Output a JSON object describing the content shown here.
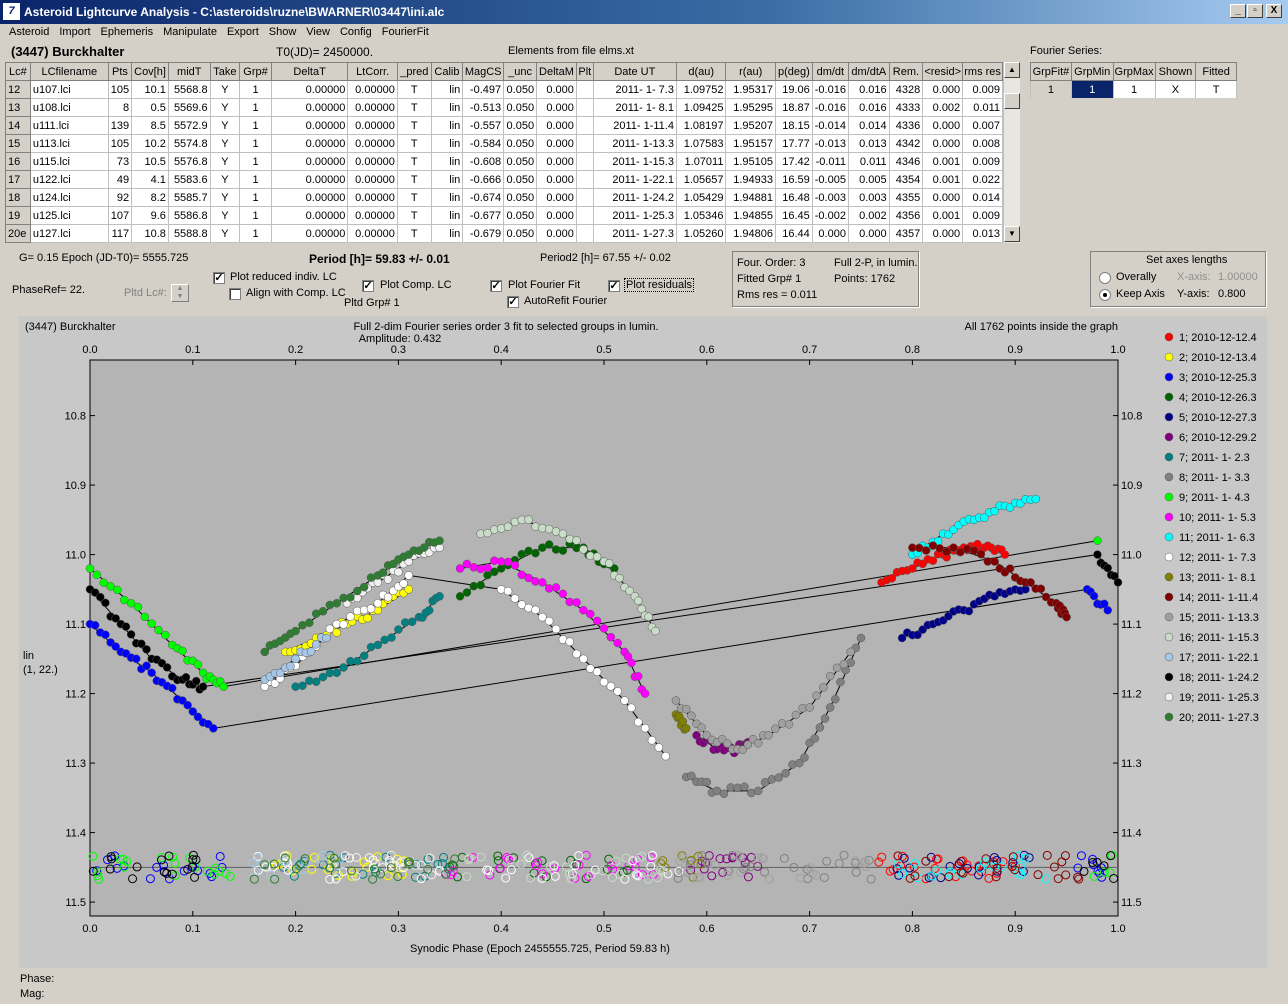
{
  "window": {
    "title": "Asteroid Lightcurve Analysis - C:\\asteroids\\ruzne\\BWARNER\\03447\\ini.alc",
    "icon_text": "7",
    "min_glyph": "_",
    "restore_glyph": "▫",
    "close_glyph": "X"
  },
  "menu": [
    "Asteroid",
    "Import",
    "Ephemeris",
    "Manipulate",
    "Export",
    "Show",
    "View",
    "Config",
    "FourierFit"
  ],
  "header": {
    "asteroid": "(3447) Burckhalter",
    "t0": "T0(JD)= 2450000.",
    "elements": "Elements from file elms.xt"
  },
  "table": {
    "columns": [
      "Lc#",
      "LCfilename",
      "Pts",
      "Cov[h]",
      "midT",
      "Take",
      "Grp#",
      "DeltaT",
      "LtCorr.",
      "_pred",
      "Calib",
      "MagCS",
      "_unc",
      "DeltaM",
      "Plt",
      "Date UT",
      "d(au)",
      "r(au)",
      "p(deg)",
      "dm/dt",
      "dm/dtA",
      "Rem.",
      "<resid>",
      "rms res"
    ],
    "rows": [
      [
        "12",
        "u107.lci",
        "105",
        "10.1",
        "5568.8",
        "Y",
        "1",
        "0.00000",
        "0.00000",
        "T",
        "lin",
        "-0.497",
        "0.050",
        "0.000",
        "",
        "2011- 1- 7.3",
        "1.09752",
        "1.95317",
        "19.06",
        "-0.016",
        "0.016",
        "4328",
        "0.000",
        "0.009"
      ],
      [
        "13",
        "u108.lci",
        "8",
        "0.5",
        "5569.6",
        "Y",
        "1",
        "0.00000",
        "0.00000",
        "T",
        "lin",
        "-0.513",
        "0.050",
        "0.000",
        "",
        "2011- 1- 8.1",
        "1.09425",
        "1.95295",
        "18.87",
        "-0.016",
        "0.016",
        "4333",
        "0.002",
        "0.011"
      ],
      [
        "14",
        "u111.lci",
        "139",
        "8.5",
        "5572.9",
        "Y",
        "1",
        "0.00000",
        "0.00000",
        "T",
        "lin",
        "-0.557",
        "0.050",
        "0.000",
        "",
        "2011- 1-11.4",
        "1.08197",
        "1.95207",
        "18.15",
        "-0.014",
        "0.014",
        "4336",
        "0.000",
        "0.007"
      ],
      [
        "15",
        "u113.lci",
        "105",
        "10.2",
        "5574.8",
        "Y",
        "1",
        "0.00000",
        "0.00000",
        "T",
        "lin",
        "-0.584",
        "0.050",
        "0.000",
        "",
        "2011- 1-13.3",
        "1.07583",
        "1.95157",
        "17.77",
        "-0.013",
        "0.013",
        "4342",
        "0.000",
        "0.008"
      ],
      [
        "16",
        "u115.lci",
        "73",
        "10.5",
        "5576.8",
        "Y",
        "1",
        "0.00000",
        "0.00000",
        "T",
        "lin",
        "-0.608",
        "0.050",
        "0.000",
        "",
        "2011- 1-15.3",
        "1.07011",
        "1.95105",
        "17.42",
        "-0.011",
        "0.011",
        "4346",
        "0.001",
        "0.009"
      ],
      [
        "17",
        "u122.lci",
        "49",
        "4.1",
        "5583.6",
        "Y",
        "1",
        "0.00000",
        "0.00000",
        "T",
        "lin",
        "-0.666",
        "0.050",
        "0.000",
        "",
        "2011- 1-22.1",
        "1.05657",
        "1.94933",
        "16.59",
        "-0.005",
        "0.005",
        "4354",
        "0.001",
        "0.022"
      ],
      [
        "18",
        "u124.lci",
        "92",
        "8.2",
        "5585.7",
        "Y",
        "1",
        "0.00000",
        "0.00000",
        "T",
        "lin",
        "-0.674",
        "0.050",
        "0.000",
        "",
        "2011- 1-24.2",
        "1.05429",
        "1.94881",
        "16.48",
        "-0.003",
        "0.003",
        "4355",
        "0.000",
        "0.014"
      ],
      [
        "19",
        "u125.lci",
        "107",
        "9.6",
        "5586.8",
        "Y",
        "1",
        "0.00000",
        "0.00000",
        "T",
        "lin",
        "-0.677",
        "0.050",
        "0.000",
        "",
        "2011- 1-25.3",
        "1.05346",
        "1.94855",
        "16.45",
        "-0.002",
        "0.002",
        "4356",
        "0.001",
        "0.009"
      ],
      [
        "20e",
        "u127.lci",
        "117",
        "10.8",
        "5588.8",
        "Y",
        "1",
        "0.00000",
        "0.00000",
        "T",
        "lin",
        "-0.679",
        "0.050",
        "0.000",
        "",
        "2011- 1-27.3",
        "1.05260",
        "1.94806",
        "16.44",
        "0.000",
        "0.000",
        "4357",
        "0.000",
        "0.013"
      ]
    ]
  },
  "fourier_series": {
    "label": "Fourier Series:",
    "columns": [
      "GrpFit#",
      "GrpMin",
      "GrpMax",
      "Shown",
      "Fitted"
    ],
    "row": [
      "1",
      "1",
      "1",
      "X",
      "T"
    ]
  },
  "controls": {
    "g_epoch": "G= 0.15    Epoch (JD-T0)= 5555.725",
    "period": "Period [h]= 59.83 +/- 0.01",
    "period2": "Period2 [h]= 67.55 +/- 0.02",
    "phaseref": "PhaseRef= 22.",
    "pltd_lc": "Pltd Lc#:",
    "pltd_grp": "Pltd Grp#  1",
    "cb_reduced": "Plot reduced indiv. LC",
    "cb_align": "Align with Comp. LC",
    "cb_comp": "Plot Comp. LC",
    "cb_fourier": "Plot Fourier Fit",
    "cb_autorefit": "AutoRefit Fourier",
    "cb_residuals": "Plot residuals",
    "info1": "Four. Order:  3",
    "info2": "Fitted Grp# 1",
    "info3": "Rms res     = 0.011",
    "info4": "Full 2-P,  in lumin.",
    "info5": "Points: 1762",
    "axes_title": "Set axes lengths",
    "axes_overall": "Overally",
    "axes_keep": "Keep Axis",
    "axes_x_label": "X-axis:",
    "axes_x_val": "1.00000",
    "axes_y_label": "Y-axis:",
    "axes_y_val": "0.800"
  },
  "status": {
    "phase": "Phase:",
    "mag": "Mag:"
  },
  "chart_data": {
    "type": "scatter",
    "title_left": "(3447) Burckhalter",
    "title": "Full 2-dim Fourier series order 3 fit to selected groups in lumin.",
    "subtitle": "Amplitude: 0.432",
    "title_right": "All 1762 points inside the graph",
    "xlabel": "Synodic Phase (Epoch 2455555.725, Period 59.83 h)",
    "ylabel": "lin",
    "ylabel2": "(1, 22.)",
    "xlim": [
      0,
      1
    ],
    "ylim": [
      11.52,
      10.72
    ],
    "y_inverted": true,
    "x_ticks": [
      "0.0",
      "0.1",
      "0.2",
      "0.3",
      "0.4",
      "0.5",
      "0.6",
      "0.7",
      "0.8",
      "0.9",
      "1.0"
    ],
    "y_ticks": [
      10.8,
      10.9,
      11.0,
      11.1,
      11.2,
      11.3,
      11.4,
      11.5
    ],
    "y_tick_labels": [
      "10.8",
      "10.9",
      "11.0",
      "11.1",
      "11.2",
      "11.3",
      "11.4",
      "11.5"
    ],
    "residual_baseline": 11.45,
    "background": "#b4b4b4",
    "series": [
      {
        "name": "1; 2010-12-12.4",
        "color": "#ff0000",
        "x": [
          0.77,
          0.8,
          0.83,
          0.85,
          0.87,
          0.89
        ],
        "y": [
          11.04,
          11.02,
          11.0,
          10.99,
          10.99,
          11.0
        ]
      },
      {
        "name": "2; 2010-12-13.4",
        "color": "#ffff00",
        "x": [
          0.19,
          0.22,
          0.25,
          0.28,
          0.31
        ],
        "y": [
          11.14,
          11.12,
          11.1,
          11.08,
          11.05
        ]
      },
      {
        "name": "3; 2010-12-25.3",
        "color": "#0000ff",
        "x": [
          0.0,
          0.03,
          0.06,
          0.09,
          0.12,
          0.97,
          0.99
        ],
        "y": [
          11.1,
          11.14,
          11.17,
          11.21,
          11.25,
          11.05,
          11.08
        ]
      },
      {
        "name": "4; 2010-12-26.3",
        "color": "#006400",
        "x": [
          0.36,
          0.4,
          0.44,
          0.48,
          0.51
        ],
        "y": [
          11.06,
          11.02,
          10.99,
          10.99,
          11.02
        ]
      },
      {
        "name": "5; 2010-12-27.3",
        "color": "#00008b",
        "x": [
          0.79,
          0.82,
          0.85,
          0.88,
          0.91
        ],
        "y": [
          11.12,
          11.1,
          11.08,
          11.06,
          11.05
        ]
      },
      {
        "name": "6; 2010-12-29.2",
        "color": "#800080",
        "x": [
          0.59,
          0.61,
          0.63,
          0.64
        ],
        "y": [
          11.26,
          11.28,
          11.28,
          11.27
        ]
      },
      {
        "name": "7; 2011- 1- 2.3",
        "color": "#008080",
        "x": [
          0.2,
          0.24,
          0.28,
          0.32,
          0.34
        ],
        "y": [
          11.19,
          11.17,
          11.13,
          11.09,
          11.06
        ]
      },
      {
        "name": "8; 2011- 1- 3.3",
        "color": "#808080",
        "x": [
          0.58,
          0.61,
          0.65,
          0.69,
          0.72,
          0.75
        ],
        "y": [
          11.32,
          11.34,
          11.34,
          11.3,
          11.22,
          11.12
        ]
      },
      {
        "name": "9; 2011- 1- 4.3",
        "color": "#00ff00",
        "x": [
          0.0,
          0.04,
          0.08,
          0.11,
          0.13,
          0.98
        ],
        "y": [
          11.02,
          11.07,
          11.13,
          11.17,
          11.19,
          10.98
        ]
      },
      {
        "name": "10; 2011- 1- 5.3",
        "color": "#ff00ff",
        "x": [
          0.36,
          0.4,
          0.44,
          0.48,
          0.52,
          0.54
        ],
        "y": [
          11.02,
          11.01,
          11.04,
          11.08,
          11.14,
          11.2
        ]
      },
      {
        "name": "11; 2011- 1- 6.3",
        "color": "#00ffff",
        "x": [
          0.8,
          0.83,
          0.86,
          0.89,
          0.92
        ],
        "y": [
          11.0,
          10.97,
          10.95,
          10.93,
          10.92
        ]
      },
      {
        "name": "12; 2011- 1- 7.3",
        "color": "#ffffff",
        "x": [
          0.17,
          0.2,
          0.24,
          0.28,
          0.31,
          0.4,
          0.44,
          0.48,
          0.52,
          0.56
        ],
        "y": [
          11.19,
          11.16,
          11.1,
          11.07,
          11.03,
          11.05,
          11.09,
          11.15,
          11.21,
          11.29
        ]
      },
      {
        "name": "13; 2011- 1- 8.1",
        "color": "#808000",
        "x": [
          0.57,
          0.58
        ],
        "y": [
          11.23,
          11.25
        ]
      },
      {
        "name": "14; 2011- 1-11.4",
        "color": "#800000",
        "x": [
          0.8,
          0.84,
          0.88,
          0.91,
          0.94,
          0.95
        ],
        "y": [
          10.99,
          10.99,
          11.01,
          11.04,
          11.07,
          11.09
        ]
      },
      {
        "name": "15; 2011- 1-13.3",
        "color": "#a0a0a0",
        "x": [
          0.57,
          0.6,
          0.63,
          0.66,
          0.7,
          0.74
        ],
        "y": [
          11.21,
          11.26,
          11.28,
          11.26,
          11.22,
          11.14
        ]
      },
      {
        "name": "16; 2011- 1-15.3",
        "color": "#c8dcc8",
        "x": [
          0.38,
          0.42,
          0.46,
          0.5,
          0.53,
          0.55
        ],
        "y": [
          10.97,
          10.95,
          10.97,
          11.01,
          11.06,
          11.11
        ]
      },
      {
        "name": "17; 2011- 1-22.1",
        "color": "#a6c8e6",
        "x": [
          0.17,
          0.2,
          0.23
        ],
        "y": [
          11.18,
          11.15,
          11.12
        ]
      },
      {
        "name": "18; 2011- 1-24.2",
        "color": "#000000",
        "x": [
          0.0,
          0.03,
          0.06,
          0.09,
          0.11,
          0.98,
          1.0
        ],
        "y": [
          11.05,
          11.1,
          11.15,
          11.18,
          11.19,
          11.0,
          11.04
        ]
      },
      {
        "name": "19; 2011- 1-25.3",
        "color": "#f0f0f0",
        "x": [
          0.25,
          0.28,
          0.31,
          0.34
        ],
        "y": [
          11.07,
          11.04,
          11.01,
          10.99
        ]
      },
      {
        "name": "20; 2011- 1-27.3",
        "color": "#2e7d32",
        "x": [
          0.17,
          0.2,
          0.24,
          0.28,
          0.31,
          0.34
        ],
        "y": [
          11.14,
          11.11,
          11.07,
          11.03,
          11.0,
          10.98
        ]
      }
    ]
  }
}
